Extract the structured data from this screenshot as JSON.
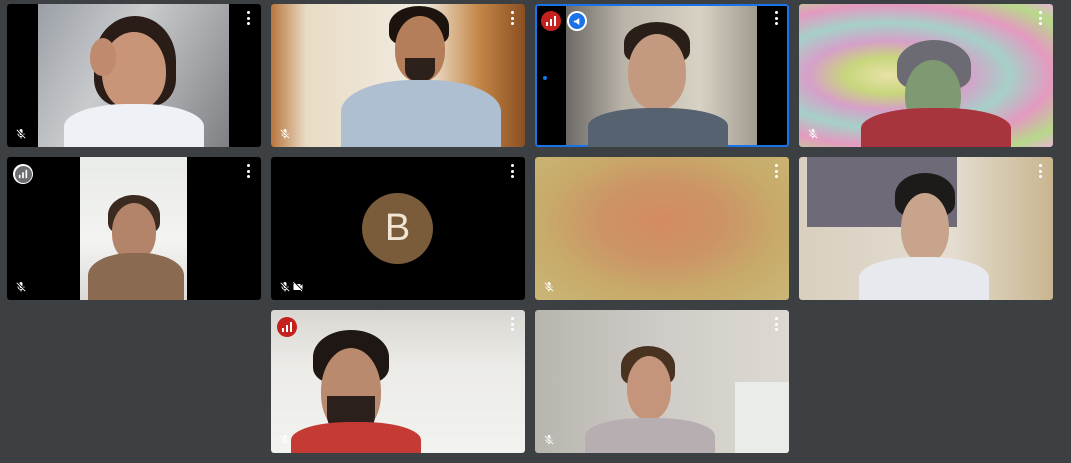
{
  "meeting": {
    "participants": [
      {
        "id": "p1",
        "name": "",
        "muted": true
      },
      {
        "id": "p2",
        "name": "",
        "muted": true
      },
      {
        "id": "p3",
        "name": "",
        "muted": false,
        "speaking": true,
        "presenting": true
      },
      {
        "id": "p4",
        "name": "",
        "muted": true
      },
      {
        "id": "p5",
        "name": "",
        "muted": true,
        "audio_level": "low"
      },
      {
        "id": "p6",
        "initial": "B",
        "muted": true,
        "camera_off": true
      },
      {
        "id": "p7",
        "name": "",
        "muted": true
      },
      {
        "id": "p8",
        "name": "",
        "muted": false
      },
      {
        "id": "p9",
        "name": "",
        "muted": true,
        "speaking": true
      },
      {
        "id": "p10",
        "name": "",
        "muted": true
      }
    ]
  },
  "colors": {
    "background": "#3c4043",
    "active_border": "#1a73e8",
    "speaking_badge": "#c5221f",
    "presenting_badge": "#1a73e8",
    "avatar_bg": "#7a5c3a"
  },
  "icons": {
    "more": "more-vert-icon",
    "mic_off": "mic-off-icon",
    "camera_off": "videocam-off-icon",
    "audio_level": "audio-level-icon",
    "presenting": "megaphone-icon"
  }
}
